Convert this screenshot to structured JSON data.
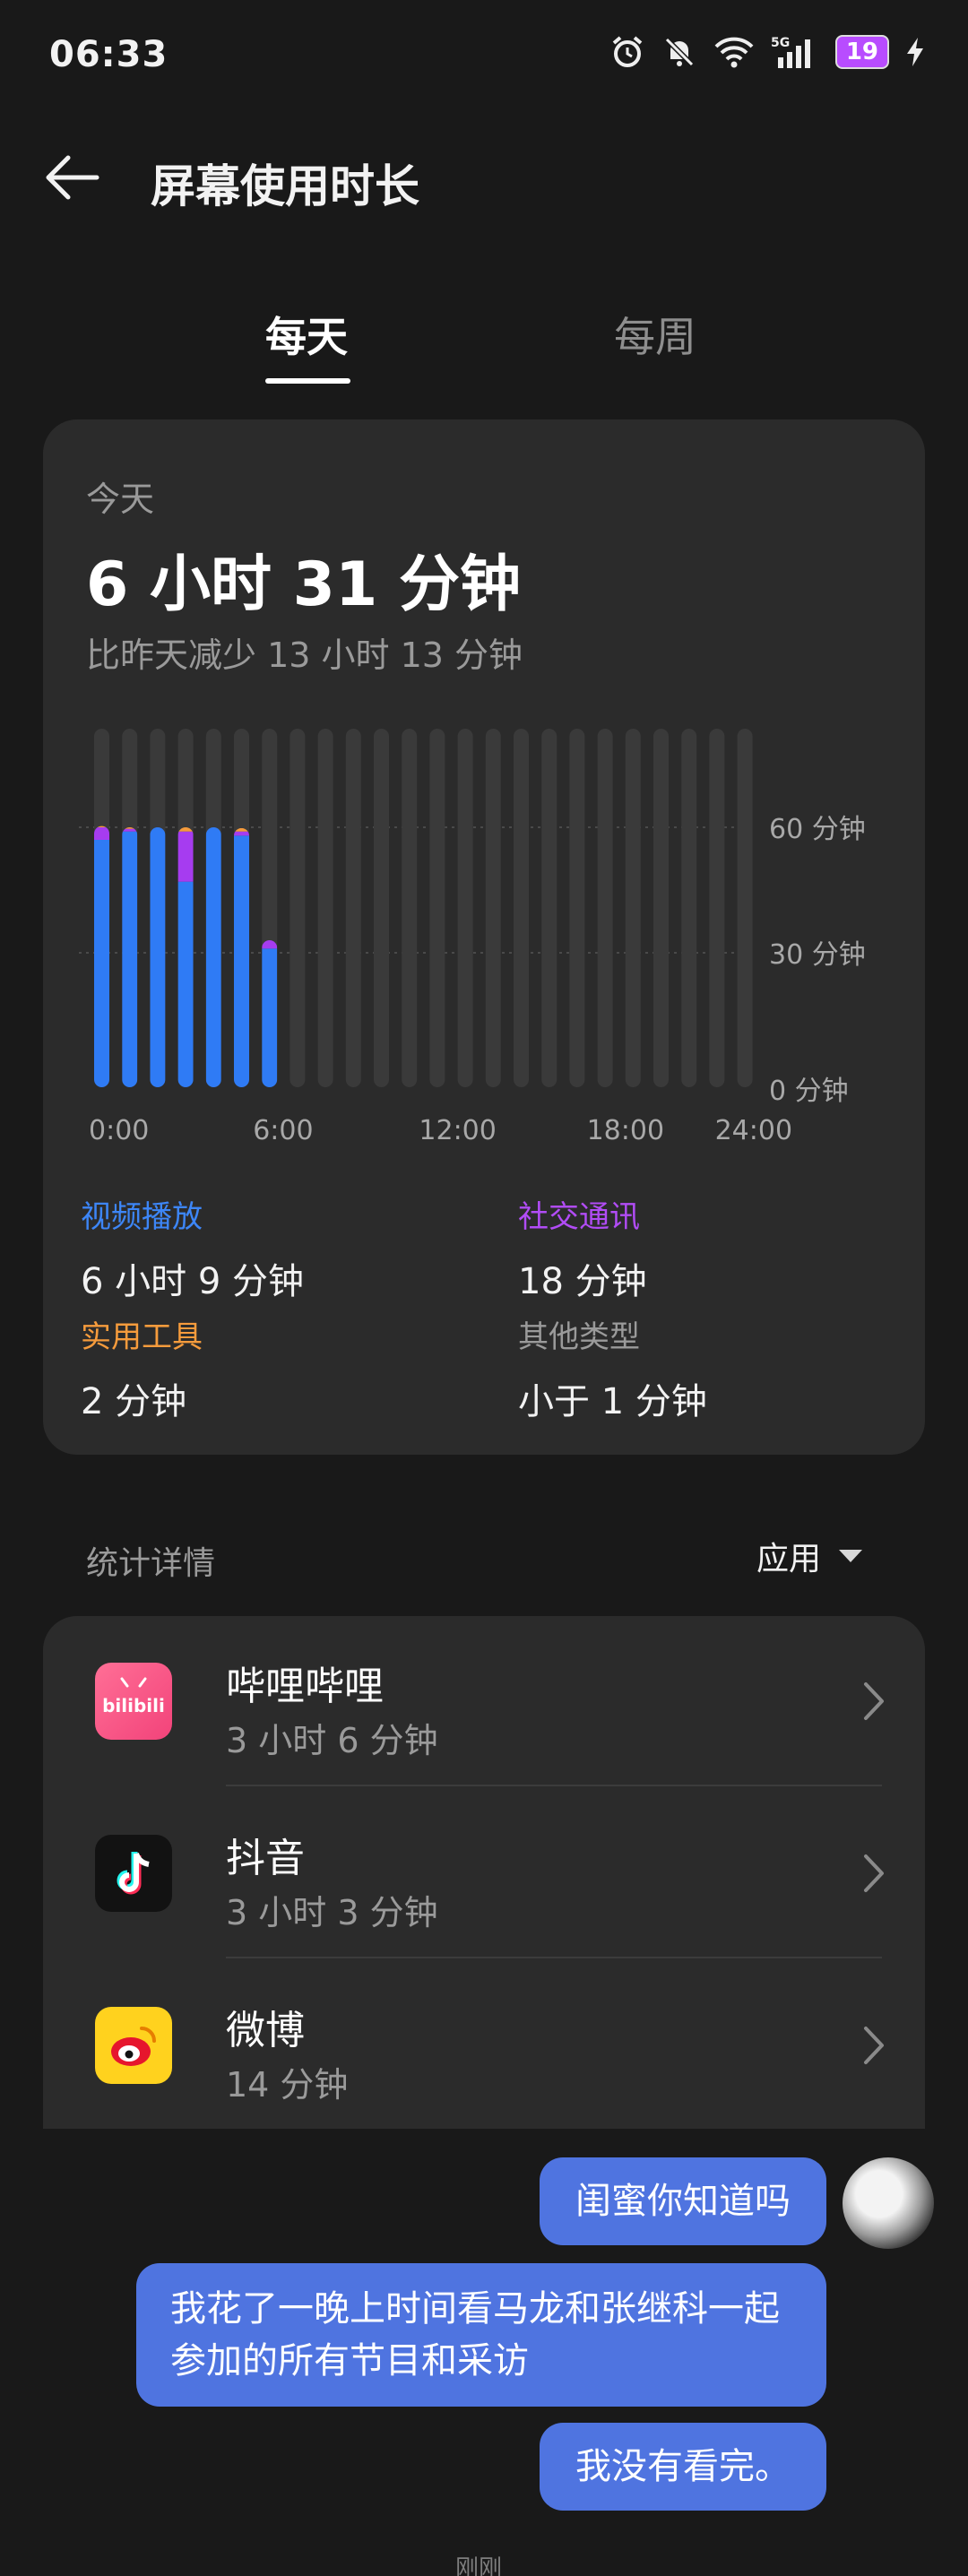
{
  "status_bar": {
    "time": "06:33",
    "network": "5G",
    "battery": "19"
  },
  "header": {
    "title": "屏幕使用时长"
  },
  "tabs": [
    {
      "label": "每天"
    },
    {
      "label": "每周"
    }
  ],
  "summary": {
    "today_label": "今天",
    "total": "6 小时 31 分钟",
    "compare": "比昨天减少 13 小时 13 分钟"
  },
  "chart_data": {
    "type": "bar",
    "stacked": true,
    "x_labels": [
      "0:00",
      "6:00",
      "12:00",
      "18:00",
      "24:00"
    ],
    "y_labels": [
      "60 分钟",
      "30 分钟",
      "0 分钟"
    ],
    "ylim": [
      0,
      60
    ],
    "hours": [
      0,
      1,
      2,
      3,
      4,
      5,
      6,
      7,
      8,
      9,
      10,
      11,
      12,
      13,
      14,
      15,
      16,
      17,
      18,
      19,
      20,
      21,
      22,
      23
    ],
    "series": [
      {
        "name": "视频播放",
        "color": "#2f7bf5",
        "values": [
          57,
          59,
          60,
          47,
          60,
          58,
          31,
          0,
          0,
          0,
          0,
          0,
          0,
          0,
          0,
          0,
          0,
          0,
          0,
          0,
          0,
          0,
          0,
          0
        ]
      },
      {
        "name": "社交通讯",
        "color": "#a63cf0",
        "values": [
          3,
          0.5,
          0,
          12,
          0,
          1,
          2,
          0,
          0,
          0,
          0,
          0,
          0,
          0,
          0,
          0,
          0,
          0,
          0,
          0,
          0,
          0,
          0,
          0
        ]
      },
      {
        "name": "实用工具",
        "color": "#f59b3c",
        "values": [
          0.3,
          0.5,
          0,
          1,
          0,
          0.8,
          0,
          0,
          0,
          0,
          0,
          0,
          0,
          0,
          0,
          0,
          0,
          0,
          0,
          0,
          0,
          0,
          0,
          0
        ]
      }
    ]
  },
  "categories": [
    {
      "label": "视频播放",
      "value": "6 小时 9 分钟",
      "color": "#3d86f7"
    },
    {
      "label": "社交通讯",
      "value": "18 分钟",
      "color": "#b14cf5"
    },
    {
      "label": "实用工具",
      "value": "2 分钟",
      "color": "#f59b3c"
    },
    {
      "label": "其他类型",
      "value": "小于 1 分钟",
      "color": "#9a9a9a"
    }
  ],
  "stats": {
    "title": "统计详情",
    "filter": "应用"
  },
  "apps": [
    {
      "name": "哔哩哔哩",
      "time": "3 小时 6 分钟",
      "icon": "bilibili-icon",
      "icon_text": "bilibili"
    },
    {
      "name": "抖音",
      "time": "3 小时 3 分钟",
      "icon": "douyin-icon"
    },
    {
      "name": "微博",
      "time": "14 分钟",
      "icon": "weibo-icon"
    }
  ],
  "chat": {
    "messages": [
      "闺蜜你知道吗",
      "我花了一晚上时间看马龙和张继科一起参加的所有节目和采访",
      "我没有看完。"
    ],
    "time": "刚刚"
  }
}
